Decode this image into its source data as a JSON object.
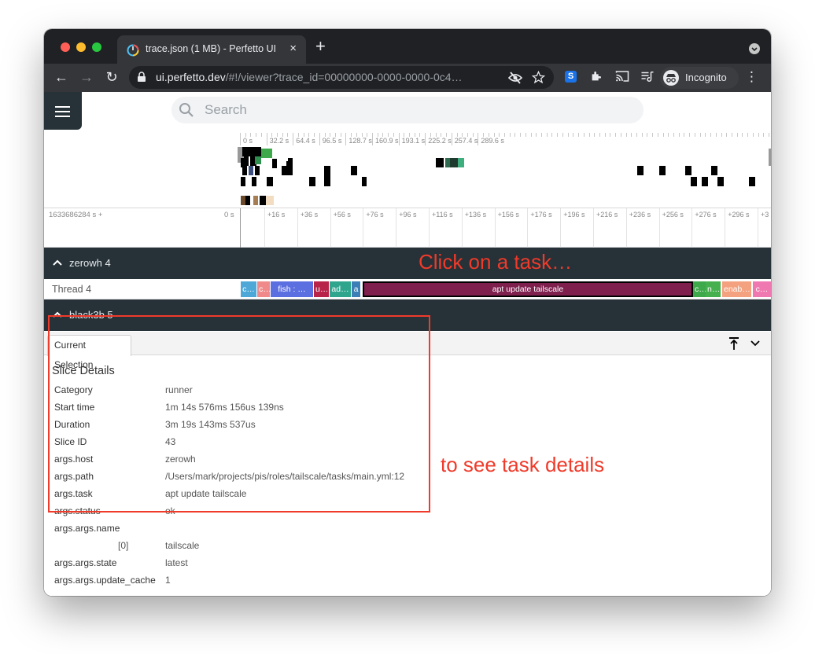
{
  "browser": {
    "tab_title": "trace.json (1 MB) - Perfetto UI",
    "tab_close": "×",
    "new_tab": "+",
    "url_host": "ui.perfetto.dev",
    "url_rest": "/#!/viewer?trace_id=00000000-0000-0000-0c4…",
    "incognito_label": "Incognito",
    "back_label": "←",
    "forward_label": "→",
    "reload_label": "↻",
    "menu_label": "⋮",
    "ext_s_label": "S"
  },
  "perfetto": {
    "search_placeholder": "Search",
    "overview_ticks": [
      "0 s",
      "32.2 s",
      "64.4 s",
      "96.5 s",
      "128.7 s",
      "160.9 s",
      "193.1 s",
      "225.2 s",
      "257.4 s",
      "289.6 s"
    ],
    "time_offset": "1633686284 s +",
    "time_zero": "0 s",
    "time_ticks": [
      "+16 s",
      "+36 s",
      "+56 s",
      "+76 s",
      "+96 s",
      "+116 s",
      "+136 s",
      "+156 s",
      "+176 s",
      "+196 s",
      "+216 s",
      "+236 s",
      "+256 s",
      "+276 s",
      "+296 s",
      "+3"
    ],
    "groups": [
      {
        "title": "zerowh 4"
      },
      {
        "title": "black3b 5"
      }
    ],
    "track_label": "Thread 4",
    "slices": [
      {
        "label": "c…",
        "color": "#4da8d8"
      },
      {
        "label": "c…",
        "color": "#f08a8a"
      },
      {
        "label": "fish : …",
        "color": "#5c6fe0"
      },
      {
        "label": "u…",
        "color": "#b8234a"
      },
      {
        "label": "ad…",
        "color": "#2fa58e"
      },
      {
        "label": "a",
        "color": "#3b7fb6"
      },
      {
        "label": "apt update tailscale",
        "color": "#7e1f4e"
      },
      {
        "label": "c…",
        "color": "#3ea94a"
      },
      {
        "label": "n…",
        "color": "#46b04e"
      },
      {
        "label": "enab…",
        "color": "#f3a17e"
      },
      {
        "label": "c…",
        "color": "#f078b0"
      }
    ]
  },
  "annotations": {
    "click_hint": "Click on a task…",
    "details_hint": "to see task details",
    "color": "#f03a2a"
  },
  "details": {
    "tab_label": "Current Selection",
    "section_title": "Slice Details",
    "rows": [
      {
        "key": "Category",
        "value": "runner"
      },
      {
        "key": "Start time",
        "value": "1m 14s 576ms 156us 139ns"
      },
      {
        "key": "Duration",
        "value": "3m 19s 143ms 537us"
      },
      {
        "key": "Slice ID",
        "value": "43"
      },
      {
        "key": "args.host",
        "value": "zerowh"
      },
      {
        "key": "args.path",
        "value": "/Users/mark/projects/pis/roles/tailscale/tasks/main.yml:12"
      },
      {
        "key": "args.task",
        "value": "apt update tailscale"
      },
      {
        "key": "args.status",
        "value": "ok"
      },
      {
        "key": "args.args.name",
        "value": ""
      },
      {
        "key": "[0]",
        "value": "tailscale"
      },
      {
        "key": "args.args.state",
        "value": "latest"
      },
      {
        "key": "args.args.update_cache",
        "value": "1"
      }
    ]
  }
}
